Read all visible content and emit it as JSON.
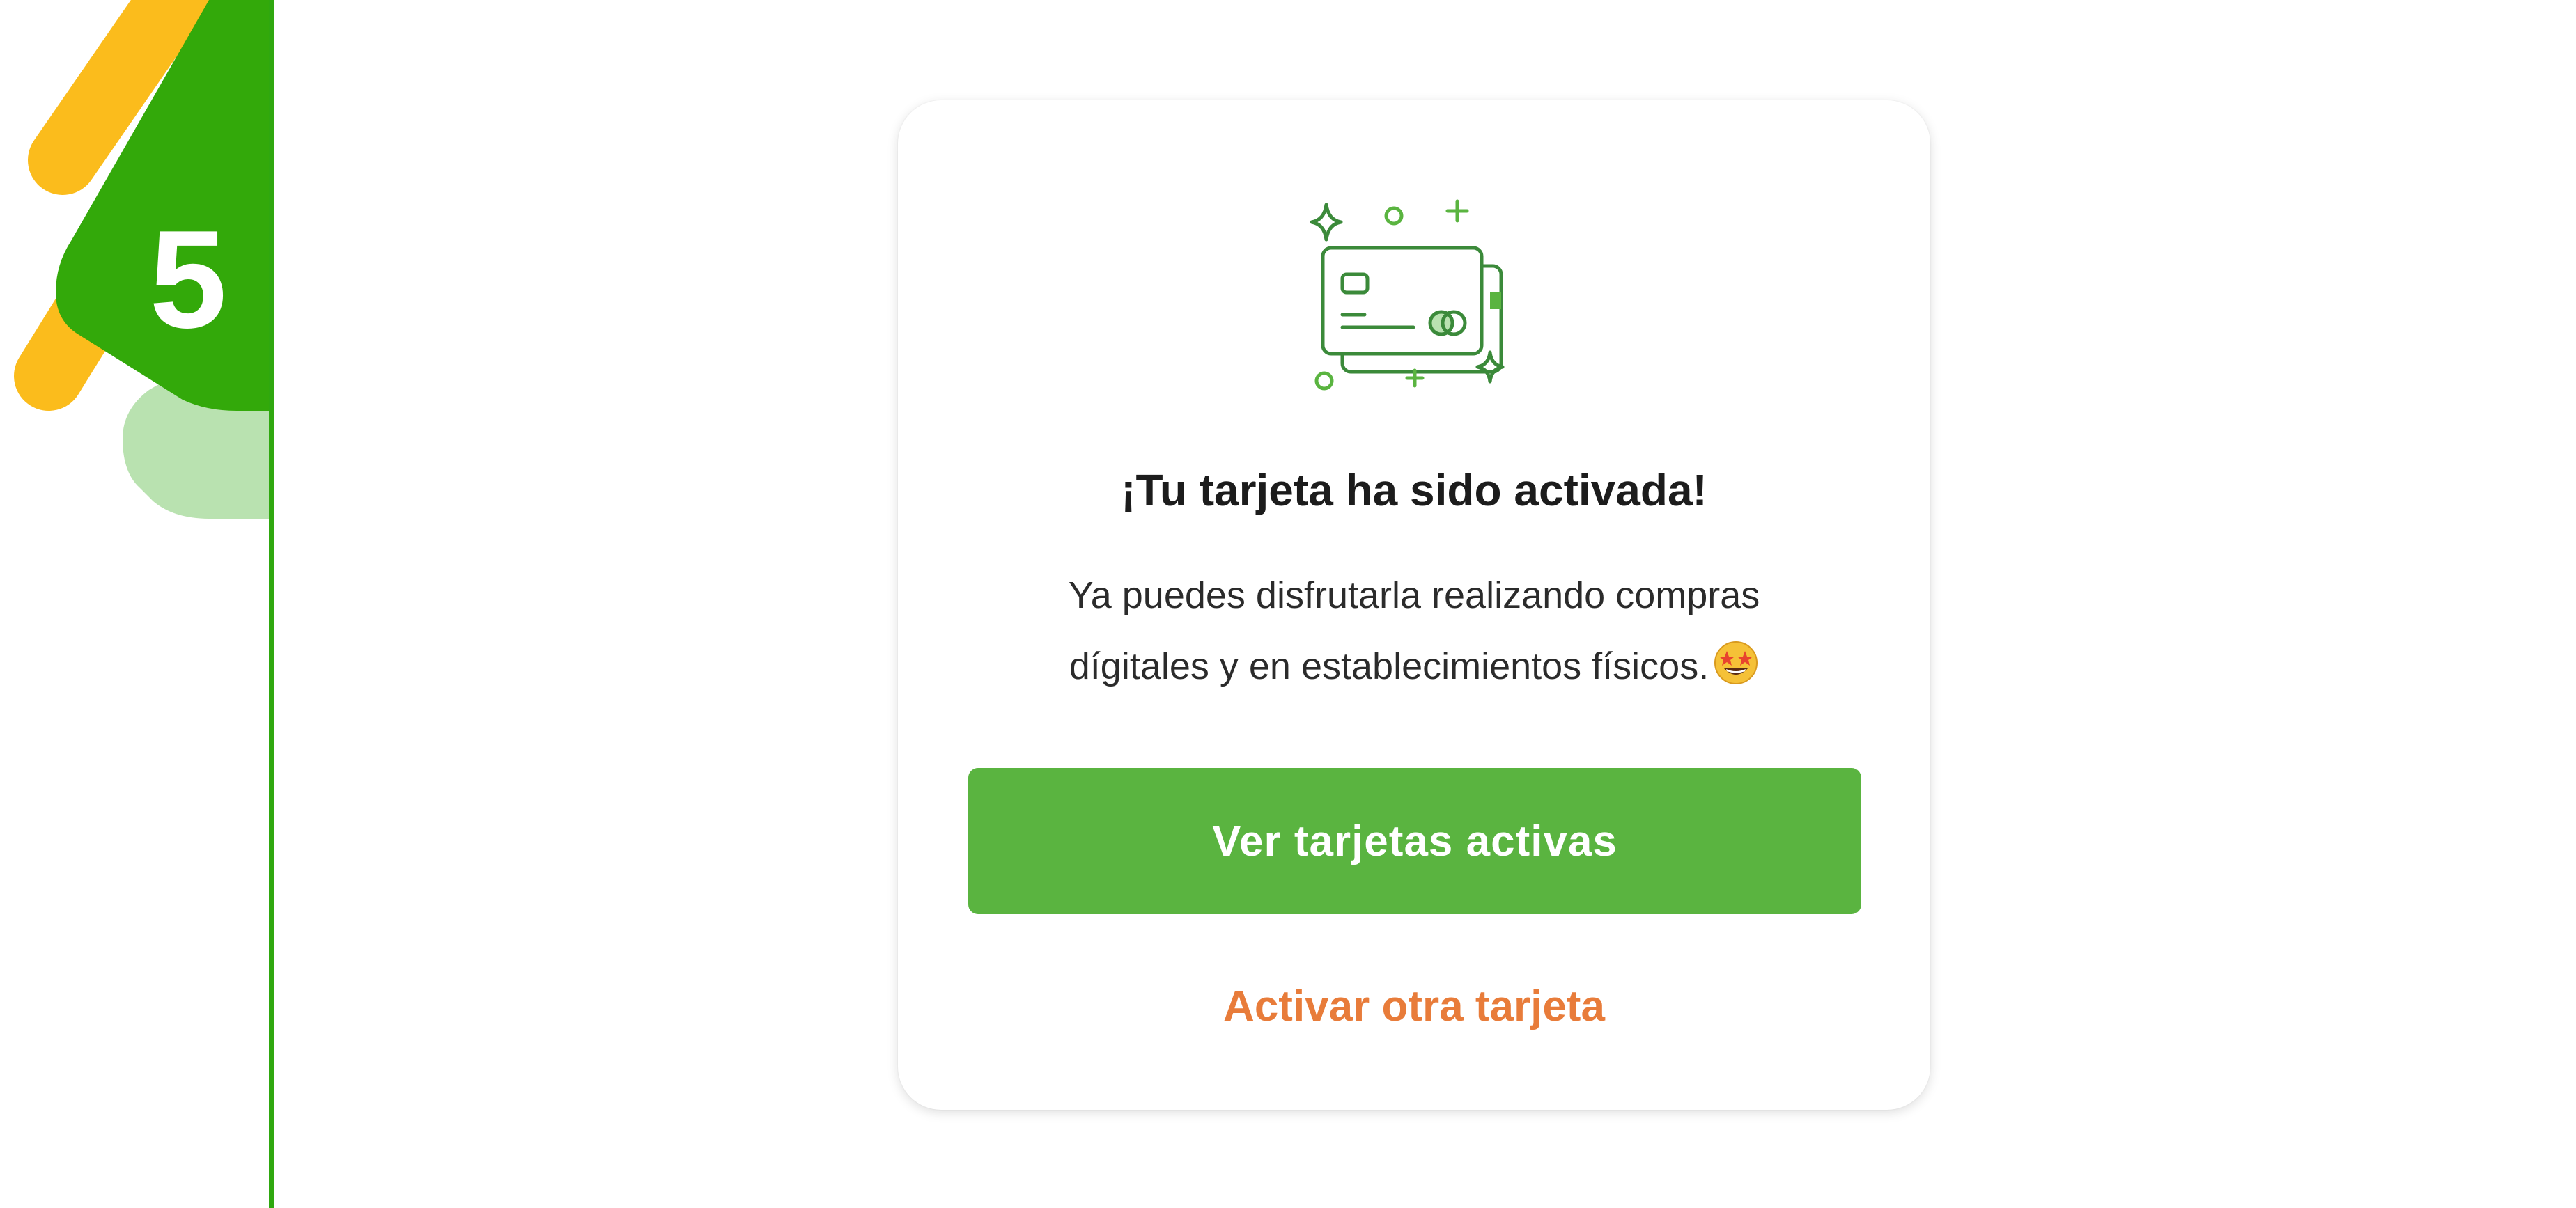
{
  "step": {
    "number": "5",
    "colors": {
      "rail": "#2fa80f",
      "badge": "#33a90a",
      "accent_yellow": "#fbbc1c",
      "accent_light_green": "#b9e2b0"
    }
  },
  "card": {
    "illustration_icon": "credit-card-sparkles-icon",
    "title": "¡Tu tarjeta ha sido activada!",
    "message_line_1": "Ya puedes disfrutarla realizando compras",
    "message_line_2": "dígitales y en establecimientos físicos.",
    "emoji_icon": "star-struck-emoji-icon",
    "primary_button_label": "Ver tarjetas activas",
    "secondary_link_label": "Activar otra tarjeta",
    "colors": {
      "primary_button": "#5ab440",
      "secondary_link": "#e87c3a",
      "illustration_stroke": "#3b8a3a"
    }
  }
}
